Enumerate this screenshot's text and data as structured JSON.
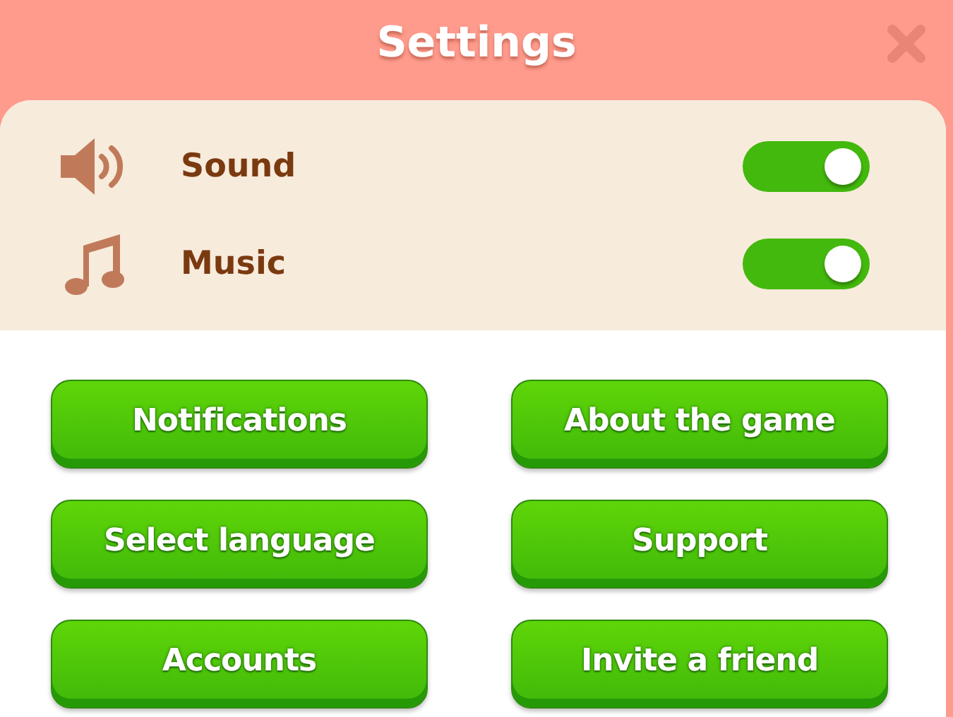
{
  "window": {
    "title": "Settings"
  },
  "toggles": [
    {
      "kind": "sound",
      "label": "Sound",
      "on": true
    },
    {
      "kind": "music",
      "label": "Music",
      "on": true
    }
  ],
  "buttons": [
    "Notifications",
    "About the game",
    "Select language",
    "Support",
    "Accounts",
    "Invite a friend"
  ]
}
